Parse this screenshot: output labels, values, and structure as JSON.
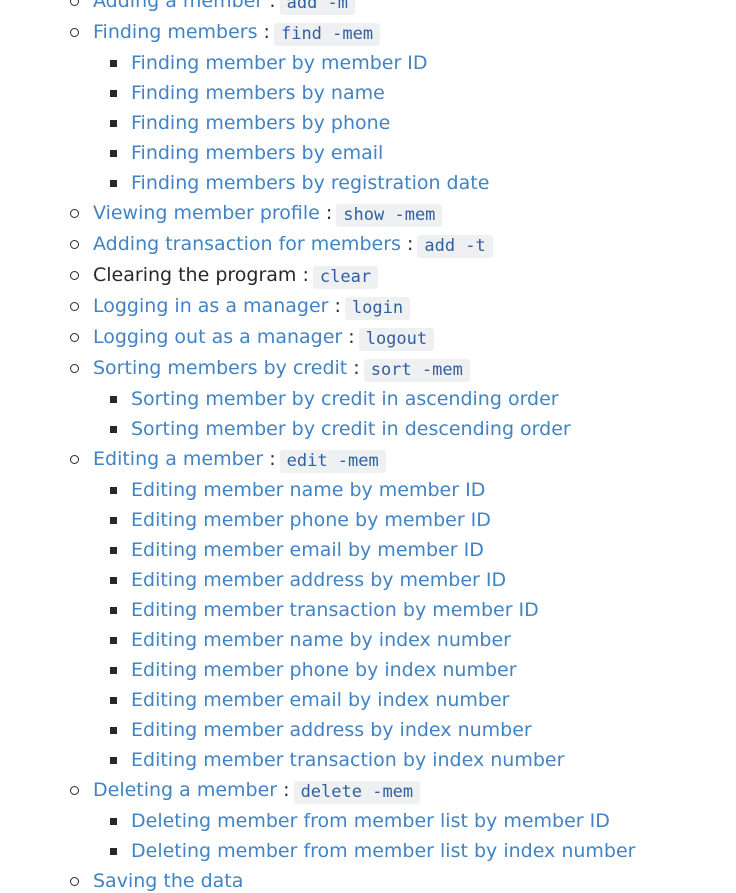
{
  "items": [
    {
      "label": "Adding a member",
      "command": "add -m",
      "link": true
    },
    {
      "label": "Finding members",
      "command": "find -mem",
      "link": true,
      "children": [
        "Finding member by member ID",
        "Finding members by name",
        "Finding members by phone",
        "Finding members by email",
        "Finding members by registration date"
      ]
    },
    {
      "label": "Viewing member profile",
      "command": "show -mem",
      "link": true
    },
    {
      "label": "Adding transaction for members",
      "command": "add -t",
      "link": true
    },
    {
      "label": "Clearing the program",
      "command": "clear",
      "link": false
    },
    {
      "label": "Logging in as a manager",
      "command": "login",
      "link": true
    },
    {
      "label": "Logging out as a manager",
      "command": "logout",
      "link": true
    },
    {
      "label": "Sorting members by credit",
      "command": "sort -mem",
      "link": true,
      "children": [
        "Sorting member by credit in ascending order",
        "Sorting member by credit in descending order"
      ]
    },
    {
      "label": "Editing a member",
      "command": "edit -mem",
      "link": true,
      "children": [
        "Editing member name by member ID",
        "Editing member phone by member ID",
        "Editing member email by member ID",
        "Editing member address by member ID",
        "Editing member transaction by member ID",
        "Editing member name by index number",
        "Editing member phone by index number",
        "Editing member email by index number",
        "Editing member address by index number",
        "Editing member transaction by index number"
      ]
    },
    {
      "label": "Deleting a member",
      "command": "delete -mem",
      "link": true,
      "children": [
        "Deleting member from member list by member ID",
        "Deleting member from member list by index number"
      ]
    },
    {
      "label": "Saving the data",
      "command": "",
      "link": true
    }
  ],
  "separator": " :"
}
